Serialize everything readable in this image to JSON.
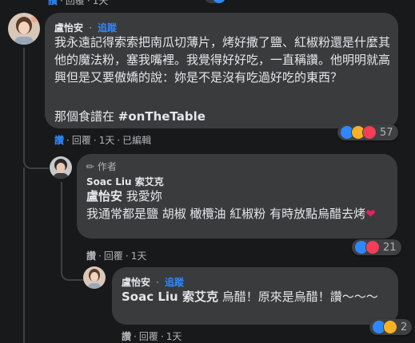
{
  "top_meta": {
    "like": "讚",
    "reply": "回覆",
    "time": "1天"
  },
  "comment1": {
    "author": "盧怡安",
    "follow": "追蹤",
    "text": "我永遠記得索索把南瓜切薄片，烤好撒了鹽、紅椒粉還是什麼其他的魔法粉，塞我嘴裡。我覺得好好吃，一直稱讚。他明明就高興但是又要傲嬌的說：妳是不是沒有吃過好吃的東西？",
    "text2": "那個食譜在 ",
    "hashtag": "#onTheTable",
    "reaction_count": "57",
    "reactions": [
      "like-icon",
      "haha-icon",
      "love-icon"
    ],
    "meta": {
      "like": "讚",
      "reply": "回覆",
      "time": "1天",
      "edited": "已編輯"
    }
  },
  "reply1": {
    "badge": "作者",
    "author": "Soac Liu 索艾克",
    "mention": "盧怡安",
    "mention_text": " 我愛妳",
    "text": "我通常都是鹽 胡椒 橄欖油 紅椒粉 有時放點烏醋去烤",
    "reaction_count": "21",
    "reactions": [
      "like-icon",
      "love-icon"
    ],
    "meta": {
      "like": "讚",
      "reply": "回覆",
      "time": "1天"
    }
  },
  "reply2": {
    "author": "盧怡安",
    "follow": "追蹤",
    "mention": "Soac Liu 索艾克",
    "text": " 烏醋！原來是烏醋！讚～～～",
    "reaction_count": "2",
    "reactions": [
      "like-icon",
      "haha-icon"
    ],
    "meta": {
      "like": "讚",
      "reply": "回覆",
      "time": "1天"
    }
  },
  "colors": {
    "background": "#18191a",
    "bubble": "#3a3b3c",
    "link": "#2d88ff",
    "like": "#2d88ff",
    "love": "#f33e58",
    "haha": "#f7b125"
  }
}
